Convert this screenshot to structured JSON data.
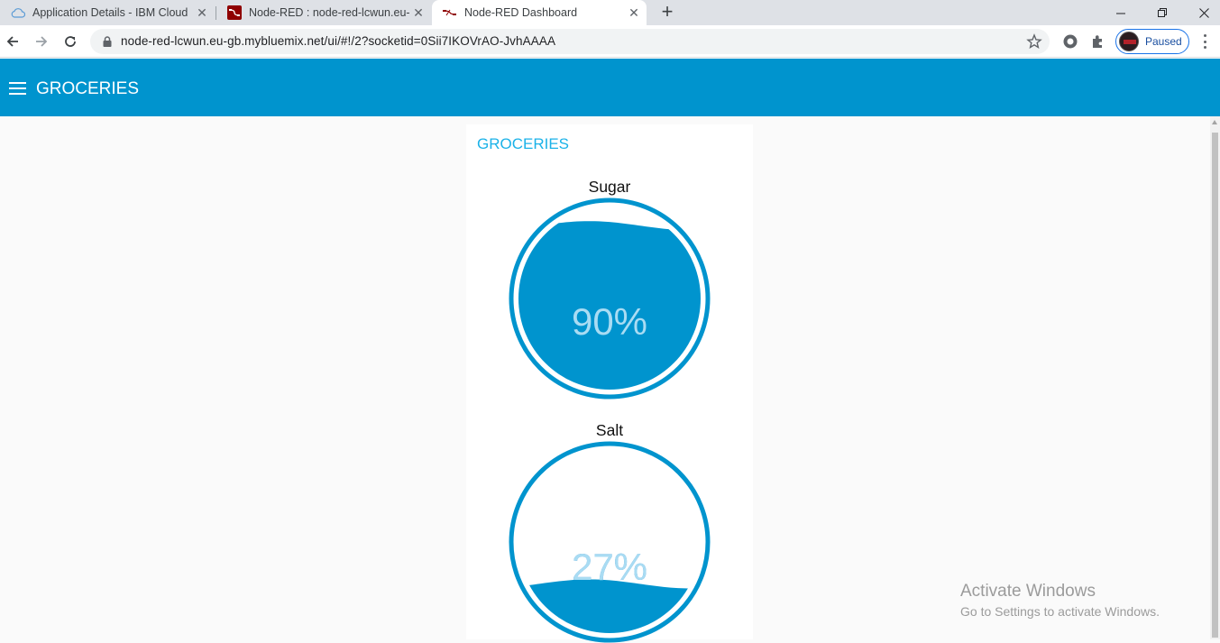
{
  "browser": {
    "tabs": [
      {
        "title": "Application Details - IBM Cloud",
        "icon": "cloud-icon"
      },
      {
        "title": "Node-RED : node-red-lcwun.eu-g",
        "icon": "node-red-icon"
      },
      {
        "title": "Node-RED Dashboard",
        "icon": "node-red-icon"
      }
    ],
    "url": "node-red-lcwun.eu-gb.mybluemix.net/ui/#!/2?socketid=0Sii7IKOVrAO-JvhAAAA",
    "profile_status": "Paused"
  },
  "dashboard": {
    "header_title": "GROCERIES",
    "group_title": "GROCERIES",
    "gauges": [
      {
        "label": "Sugar",
        "value": 90,
        "display": "90%"
      },
      {
        "label": "Salt",
        "value": 27,
        "display": "27%"
      }
    ],
    "colors": {
      "accent": "#0094ce",
      "group_title": "#1bb2e8"
    }
  },
  "watermark": {
    "line1": "Activate Windows",
    "line2": "Go to Settings to activate Windows."
  }
}
